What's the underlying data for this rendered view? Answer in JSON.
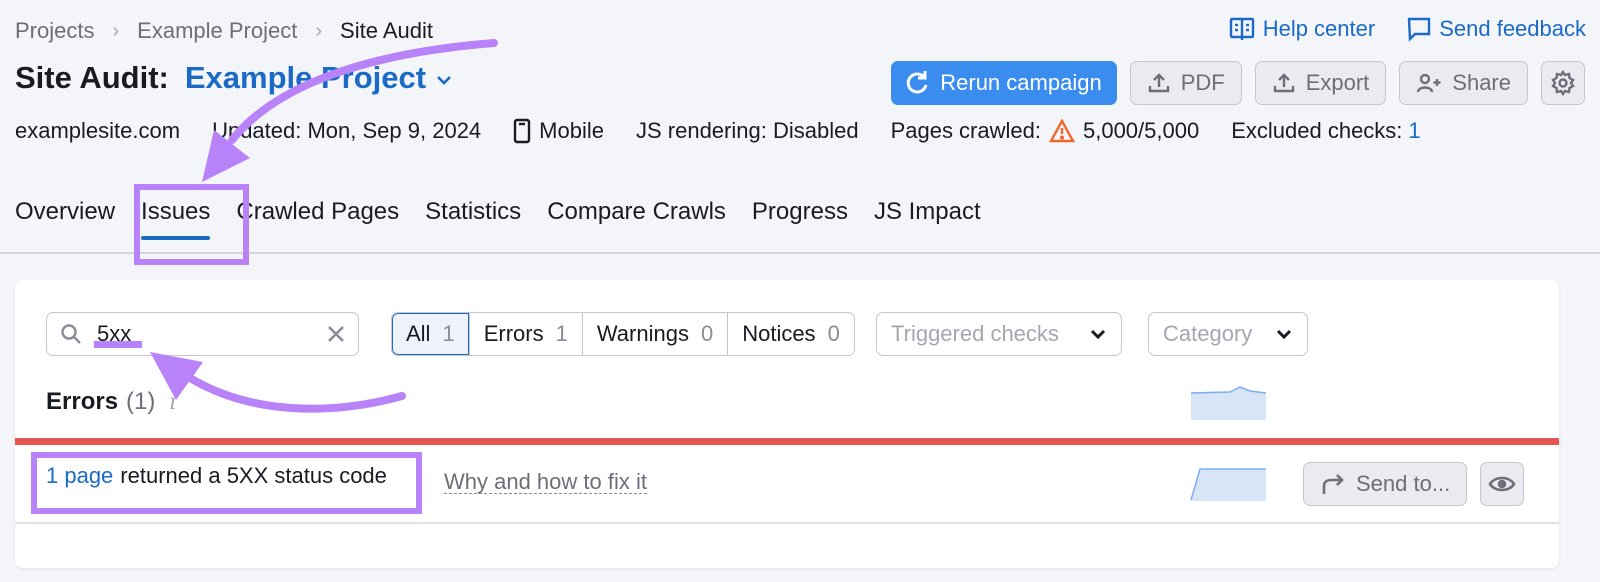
{
  "breadcrumb": [
    "Projects",
    "Example Project",
    "Site Audit"
  ],
  "top_links": {
    "help": {
      "label": "Help center",
      "icon": "book-icon"
    },
    "feedback": {
      "label": "Send feedback",
      "icon": "chat-icon"
    }
  },
  "title": {
    "prefix": "Site Audit:",
    "project": "Example Project"
  },
  "actions": {
    "rerun": "Rerun campaign",
    "pdf": "PDF",
    "export": "Export",
    "share": "Share"
  },
  "meta": {
    "domain": "examplesite.com",
    "updated": "Updated: Mon, Sep 9, 2024",
    "device": "Mobile",
    "js_rendering": "JS rendering: Disabled",
    "pages_crawled_label": "Pages crawled:",
    "pages_crawled_value": "5,000/5,000",
    "excluded_label": "Excluded checks:",
    "excluded_value": "1"
  },
  "tabs": [
    {
      "label": "Overview",
      "active": false
    },
    {
      "label": "Issues",
      "active": true
    },
    {
      "label": "Crawled Pages",
      "active": false
    },
    {
      "label": "Statistics",
      "active": false
    },
    {
      "label": "Compare Crawls",
      "active": false
    },
    {
      "label": "Progress",
      "active": false
    },
    {
      "label": "JS Impact",
      "active": false
    }
  ],
  "filters": {
    "search_value": "5xx",
    "segments": [
      {
        "label": "All",
        "count": "1",
        "active": true
      },
      {
        "label": "Errors",
        "count": "1",
        "active": false
      },
      {
        "label": "Warnings",
        "count": "0",
        "active": false
      },
      {
        "label": "Notices",
        "count": "0",
        "active": false
      }
    ],
    "triggered_checks": "Triggered checks",
    "category": "Category"
  },
  "errors_section": {
    "title": "Errors",
    "count": "(1)",
    "info": "i"
  },
  "issue": {
    "link": "1 page",
    "text": "returned a 5XX status code",
    "fix_link": "Why and how to fix it",
    "send_to": "Send to..."
  },
  "colors": {
    "accent": "#1a6ac6",
    "primary_button": "#3a8cef",
    "error_line": "#e95454",
    "annotation": "#b883f8",
    "warning": "#f0662d"
  }
}
